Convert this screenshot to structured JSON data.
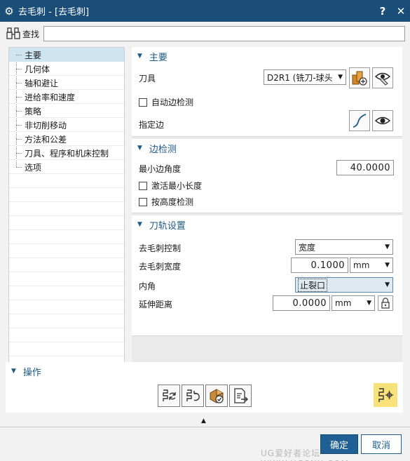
{
  "window": {
    "title": "去毛刺 - [去毛刺]",
    "help_label": "?",
    "close_label": "✕"
  },
  "search": {
    "label": "查找",
    "value": ""
  },
  "tree": {
    "items": [
      "主要",
      "几何体",
      "轴和避让",
      "进给率和速度",
      "策略",
      "非切削移动",
      "方法和公差",
      "刀具、程序和机床控制",
      "选项"
    ],
    "selected": "主要"
  },
  "main_section": {
    "title": "主要",
    "tool_label": "刀具",
    "tool_value": "D2R1 (铣刀-球头",
    "auto_edge_label": "自动边检测",
    "auto_edge_checked": false,
    "specify_edge_label": "指定边"
  },
  "edge_section": {
    "title": "边检测",
    "min_angle_label": "最小边角度",
    "min_angle_value": "40.0000",
    "activate_min_length_label": "激活最小长度",
    "activate_min_length_checked": false,
    "height_check_label": "按高度检测",
    "height_check_checked": false
  },
  "path_section": {
    "title": "刀轨设置",
    "deburr_control_label": "去毛刺控制",
    "deburr_control_value": "宽度",
    "deburr_width_label": "去毛刺宽度",
    "deburr_width_value": "0.1000",
    "deburr_width_unit": "mm",
    "inner_corner_label": "内角",
    "inner_corner_value": "止裂口",
    "extend_distance_label": "延伸距离",
    "extend_distance_value": "0.0000",
    "extend_distance_unit": "mm"
  },
  "operations": {
    "title": "操作"
  },
  "buttons": {
    "ok": "确定",
    "cancel": "取消"
  },
  "watermark": "UG爱好者论坛 WWW.UGSNX.COM",
  "colors": {
    "title_bar": "#1a4d78",
    "accent": "#1d5a86",
    "highlight": "#f7e27a",
    "selected_row": "#cfe4f1"
  }
}
